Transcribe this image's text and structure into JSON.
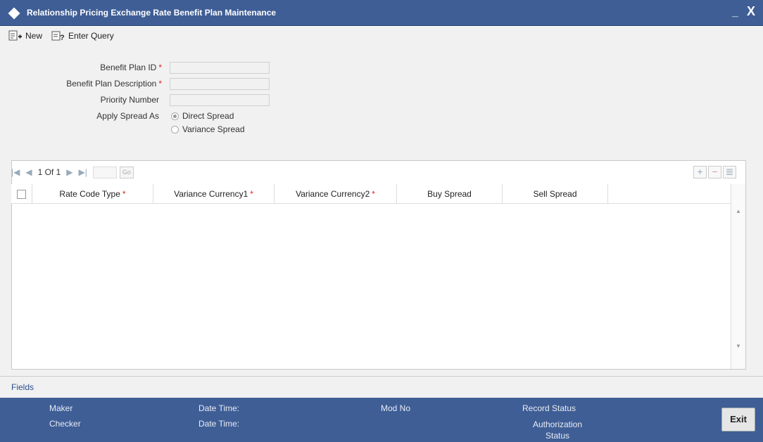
{
  "window": {
    "title": "Relationship Pricing Exchange Rate Benefit Plan Maintenance",
    "minimize_label": "_",
    "close_label": "X"
  },
  "toolbar": {
    "new_label": "New",
    "enter_query_label": "Enter Query"
  },
  "form": {
    "benefit_plan_id_label": "Benefit Plan ID",
    "benefit_plan_description_label": "Benefit Plan Description",
    "priority_number_label": "Priority Number",
    "apply_spread_as_label": "Apply Spread As",
    "required_mark": "*",
    "spread_options": [
      {
        "label": "Direct Spread",
        "selected": true
      },
      {
        "label": "Variance Spread",
        "selected": false
      }
    ]
  },
  "grid": {
    "page_indicator": "1 Of 1",
    "go_label": "Go",
    "columns": [
      "Rate Code Type",
      "Variance Currency1",
      "Variance Currency2",
      "Buy Spread",
      "Sell Spread"
    ],
    "required_columns": [
      true,
      true,
      true,
      false,
      false
    ],
    "rows": []
  },
  "fields_link": "Fields",
  "footer": {
    "maker_label": "Maker",
    "checker_label": "Checker",
    "date_time_label_1": "Date Time:",
    "date_time_label_2": "Date Time:",
    "mod_no_label": "Mod No",
    "record_status_label": "Record Status",
    "authorization_status_label": "Authorization Status",
    "exit_label": "Exit"
  },
  "colors": {
    "titlebar": "#3f5e96",
    "panel": "#f1f1f1",
    "required": "#dd2222"
  }
}
